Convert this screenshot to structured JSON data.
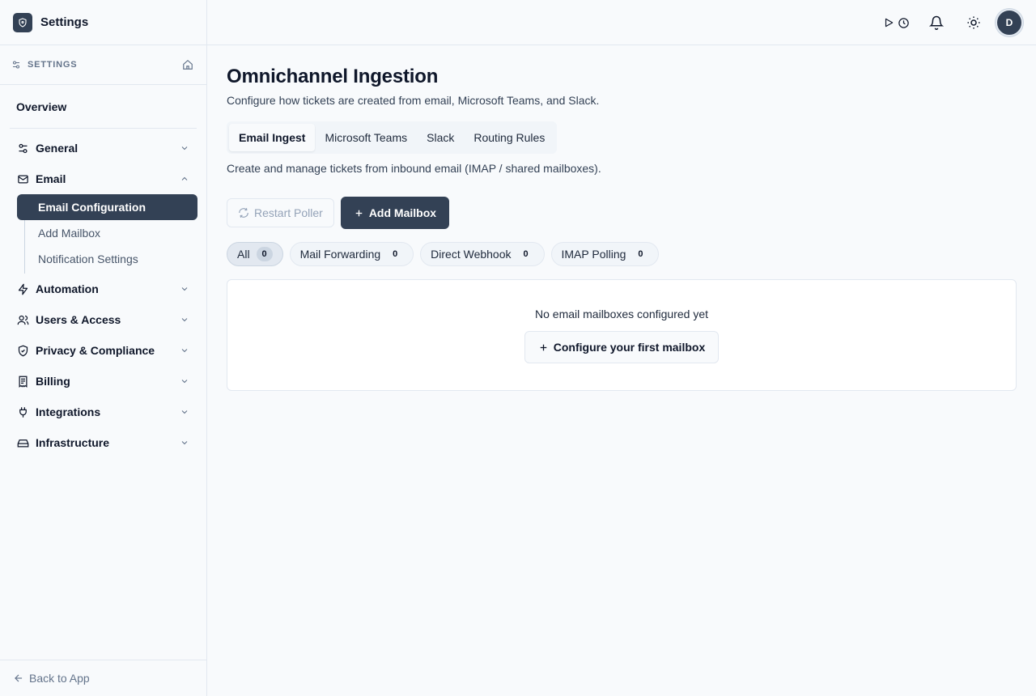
{
  "app": {
    "title": "Settings"
  },
  "sidebar": {
    "section_label": "SETTINGS",
    "overview": "Overview",
    "groups": [
      {
        "label": "General",
        "icon": "sliders-icon",
        "expanded": false
      },
      {
        "label": "Email",
        "icon": "mail-icon",
        "expanded": true,
        "items": [
          {
            "label": "Email Configuration",
            "active": true
          },
          {
            "label": "Add Mailbox",
            "active": false
          },
          {
            "label": "Notification Settings",
            "active": false
          }
        ]
      },
      {
        "label": "Automation",
        "icon": "lightning-icon",
        "expanded": false
      },
      {
        "label": "Users & Access",
        "icon": "users-icon",
        "expanded": false
      },
      {
        "label": "Privacy & Compliance",
        "icon": "shield-icon",
        "expanded": false
      },
      {
        "label": "Billing",
        "icon": "receipt-icon",
        "expanded": false
      },
      {
        "label": "Integrations",
        "icon": "plug-icon",
        "expanded": false
      },
      {
        "label": "Infrastructure",
        "icon": "hard-drive-icon",
        "expanded": false
      }
    ],
    "footer": "Back to App"
  },
  "topbar": {
    "avatar_initial": "D"
  },
  "main": {
    "title": "Omnichannel Ingestion",
    "subtitle": "Configure how tickets are created from email, Microsoft Teams, and Slack.",
    "tabs": [
      {
        "label": "Email Ingest",
        "active": true
      },
      {
        "label": "Microsoft Teams",
        "active": false
      },
      {
        "label": "Slack",
        "active": false
      },
      {
        "label": "Routing Rules",
        "active": false
      }
    ],
    "tab_description": "Create and manage tickets from inbound email (IMAP / shared mailboxes).",
    "actions": {
      "restart": "Restart Poller",
      "add": "Add Mailbox"
    },
    "filters": [
      {
        "label": "All",
        "count": "0",
        "active": true
      },
      {
        "label": "Mail Forwarding",
        "count": "0",
        "active": false
      },
      {
        "label": "Direct Webhook",
        "count": "0",
        "active": false
      },
      {
        "label": "IMAP Polling",
        "count": "0",
        "active": false
      }
    ],
    "empty": {
      "message": "No email mailboxes configured yet",
      "cta": "Configure your first mailbox"
    }
  },
  "colors": {
    "accent": "#334155",
    "border": "#e2e8f0",
    "background": "#f8fafc"
  }
}
